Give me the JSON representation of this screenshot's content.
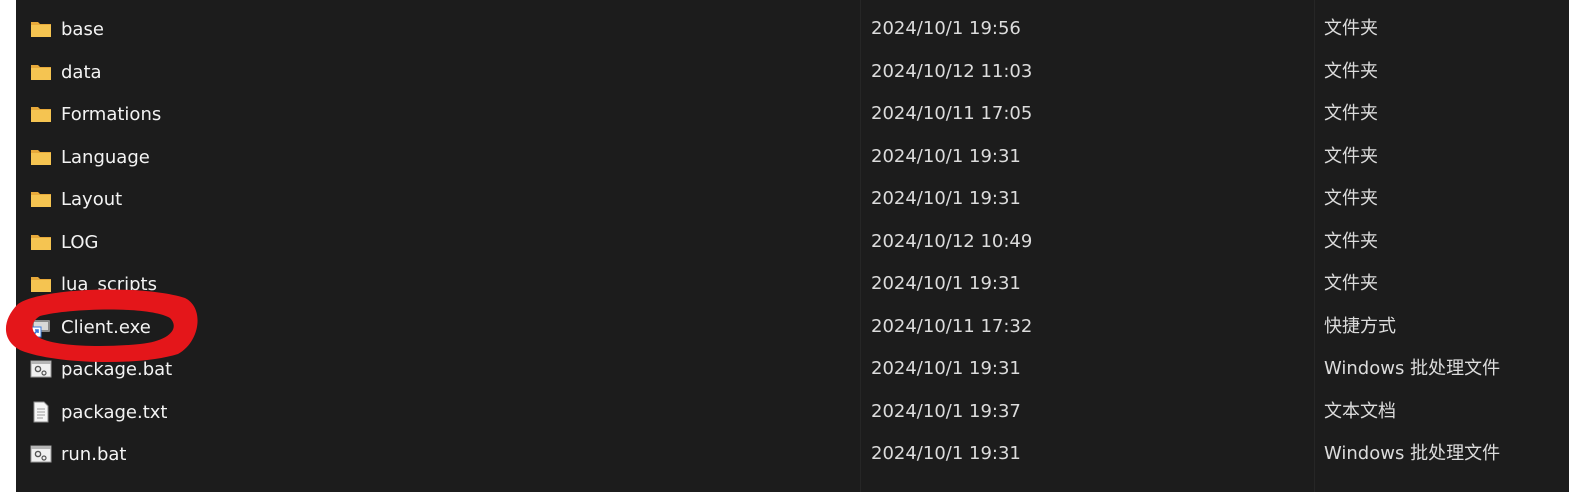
{
  "files": [
    {
      "name": "base",
      "date": "2024/10/1 19:56",
      "type": "文件夹",
      "icon": "folder-icon"
    },
    {
      "name": "data",
      "date": "2024/10/12 11:03",
      "type": "文件夹",
      "icon": "folder-icon"
    },
    {
      "name": "Formations",
      "date": "2024/10/11 17:05",
      "type": "文件夹",
      "icon": "folder-icon"
    },
    {
      "name": "Language",
      "date": "2024/10/1 19:31",
      "type": "文件夹",
      "icon": "folder-icon"
    },
    {
      "name": "Layout",
      "date": "2024/10/1 19:31",
      "type": "文件夹",
      "icon": "folder-icon"
    },
    {
      "name": "LOG",
      "date": "2024/10/12 10:49",
      "type": "文件夹",
      "icon": "folder-icon"
    },
    {
      "name": "lua_scripts",
      "date": "2024/10/1 19:31",
      "type": "文件夹",
      "icon": "folder-icon"
    },
    {
      "name": "Client.exe",
      "date": "2024/10/11 17:32",
      "type": "快捷方式",
      "icon": "shortcut-icon"
    },
    {
      "name": "package.bat",
      "date": "2024/10/1 19:31",
      "type": "Windows 批处理文件",
      "icon": "batch-file-icon"
    },
    {
      "name": "package.txt",
      "date": "2024/10/1 19:37",
      "type": "文本文档",
      "icon": "text-file-icon"
    },
    {
      "name": "run.bat",
      "date": "2024/10/1 19:31",
      "type": "Windows 批处理文件",
      "icon": "batch-file-icon"
    }
  ],
  "colors": {
    "background": "#1c1c1c",
    "text": "#f3f3f3",
    "folder": "#f2c14e",
    "annotation": "#e4161a"
  }
}
